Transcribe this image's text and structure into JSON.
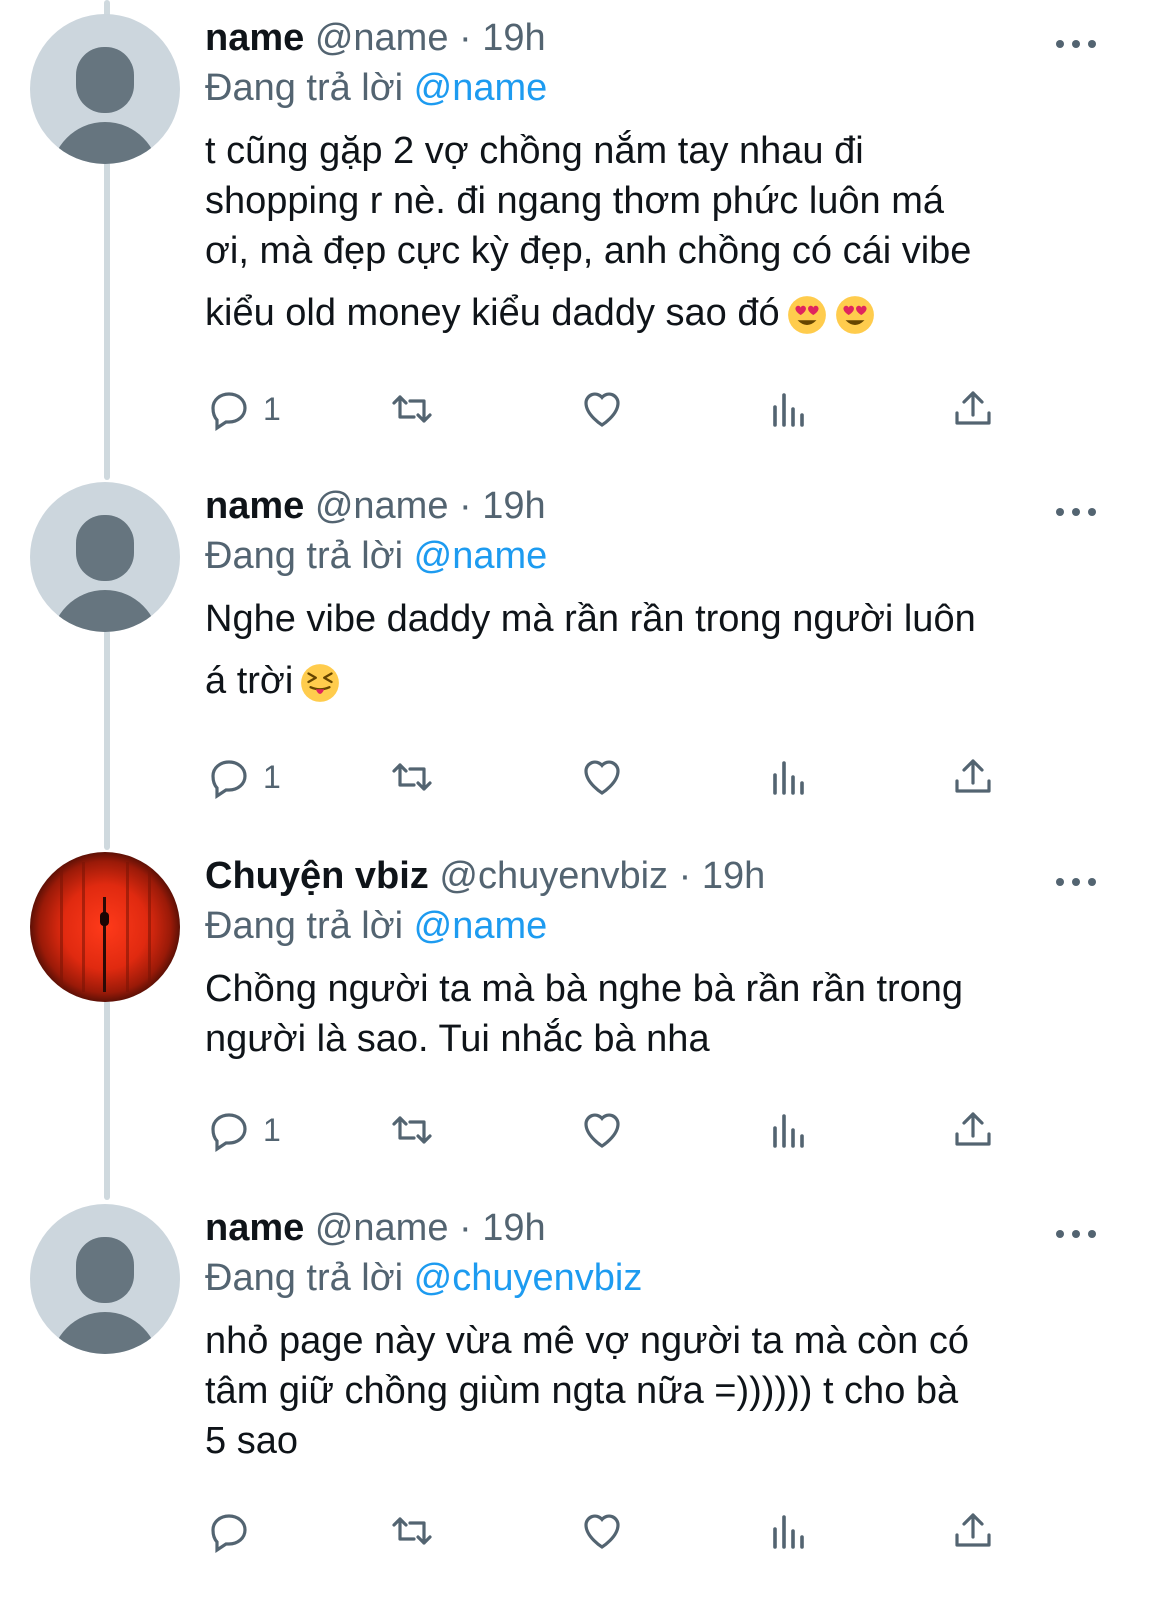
{
  "tweets": [
    {
      "display_name": "name",
      "handle": "@name",
      "time": "19h",
      "replying_prefix": "Đang trả lời ",
      "replying_to": "@name",
      "text_lines": "t cũng gặp 2 vợ chồng nắm tay nhau đi\nshopping r nè. đi ngang thơm phức luôn má\nơi, mà đẹp cực kỳ đẹp, anh chồng có cái vibe",
      "text_last": "kiểu old money kiểu daddy sao đó",
      "emojis": [
        "heart-eyes-emoji",
        "heart-eyes-emoji"
      ],
      "reply_count": "1"
    },
    {
      "display_name": "name",
      "handle": "@name",
      "time": "19h",
      "replying_prefix": "Đang trả lời ",
      "replying_to": "@name",
      "text_lines": "Nghe vibe daddy mà rần rần trong người luôn",
      "text_last": "á trời",
      "emojis": [
        "squinting-tongue-emoji"
      ],
      "reply_count": "1"
    },
    {
      "display_name": "Chuyện vbiz",
      "handle": "@chuyenvbiz",
      "time": "19h",
      "replying_prefix": "Đang trả lời ",
      "replying_to": "@name",
      "text_lines": "Chồng người ta mà bà nghe bà rần rần trong\nngười là sao. Tui nhắc bà nha",
      "text_last": "",
      "emojis": [],
      "reply_count": "1"
    },
    {
      "display_name": "name",
      "handle": "@name",
      "time": "19h",
      "replying_prefix": "Đang trả lời ",
      "replying_to": "@chuyenvbiz",
      "text_lines": "nhỏ page này vừa mê vợ người ta mà còn có\ntâm giữ chồng giùm ngta nữa =)))))) t cho bà\n5 sao",
      "text_last": "",
      "emojis": [],
      "reply_count": ""
    }
  ],
  "separator": " · ",
  "colors": {
    "text": "#0f1419",
    "secondary": "#536471",
    "link": "#1d9bf0",
    "thread_line": "#cfd9de"
  }
}
